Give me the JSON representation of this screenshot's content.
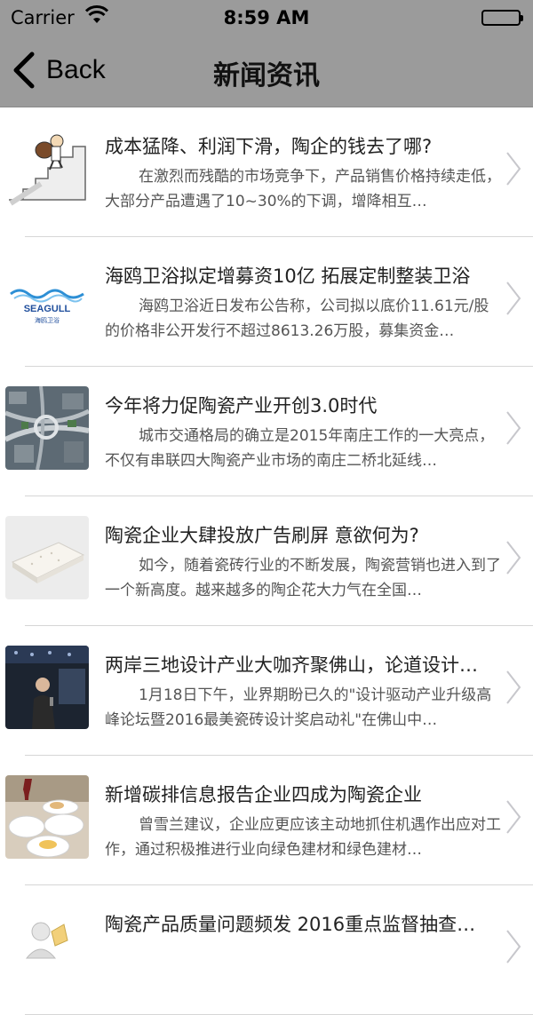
{
  "status_bar": {
    "carrier": "Carrier",
    "time": "8:59 AM",
    "icons": [
      "wifi-icon",
      "battery-icon"
    ]
  },
  "nav": {
    "back_label": "Back",
    "title": "新闻资讯"
  },
  "news": [
    {
      "headline": "成本猛降、利润下滑，陶企的钱去了哪?",
      "summary": "在激烈而残酷的市场竞争下，产品销售价格持续走低，大部分产品遭遇了10~30%的下调，增降相互…",
      "thumb": "climbing-stairs-cartoon"
    },
    {
      "headline": "海鸥卫浴拟定增募资10亿 拓展定制整装卫浴",
      "summary": "海鸥卫浴近日发布公告称，公司拟以底价11.61元/股的价格非公开发行不超过8613.26万股，募集资金…",
      "thumb": "seagull-logo",
      "thumb_text_en": "SEAGULL",
      "thumb_text_cn": "海鸥卫浴"
    },
    {
      "headline": "今年将力促陶瓷产业开创3.0时代",
      "summary": "城市交通格局的确立是2015年南庄工作的一大亮点，不仅有串联四大陶瓷产业市场的南庄二桥北延线…",
      "thumb": "aerial-city-photo"
    },
    {
      "headline": "陶瓷企业大肆投放广告刷屏 意欲何为?",
      "summary": "如今，随着瓷砖行业的不断发展，陶瓷营销也进入到了一个新高度。越来越多的陶企花大力气在全国…",
      "thumb": "ceramic-tile-photo"
    },
    {
      "headline": "两岸三地设计产业大咖齐聚佛山，论道设计…",
      "summary": "1月18日下午，业界期盼已久的\"设计驱动产业升级高峰论坛暨2016最美瓷砖设计奖启动礼\"在佛山中…",
      "thumb": "speaker-stage-photo"
    },
    {
      "headline": "新增碳排信息报告企业四成为陶瓷企业",
      "summary": "曾雪兰建议，企业应更应该主动地抓住机遇作出应对工作，通过积极推进行业向绿色建材和绿色建材…",
      "thumb": "tableware-photo"
    },
    {
      "headline": "陶瓷产品质量问题频发 2016重点监督抽查…",
      "summary": "",
      "thumb": "figure-cartoon"
    }
  ],
  "colors": {
    "bar_bg": "#9b9b9b",
    "separator": "#d6d6d6",
    "chevron": "#c7c7cc"
  }
}
